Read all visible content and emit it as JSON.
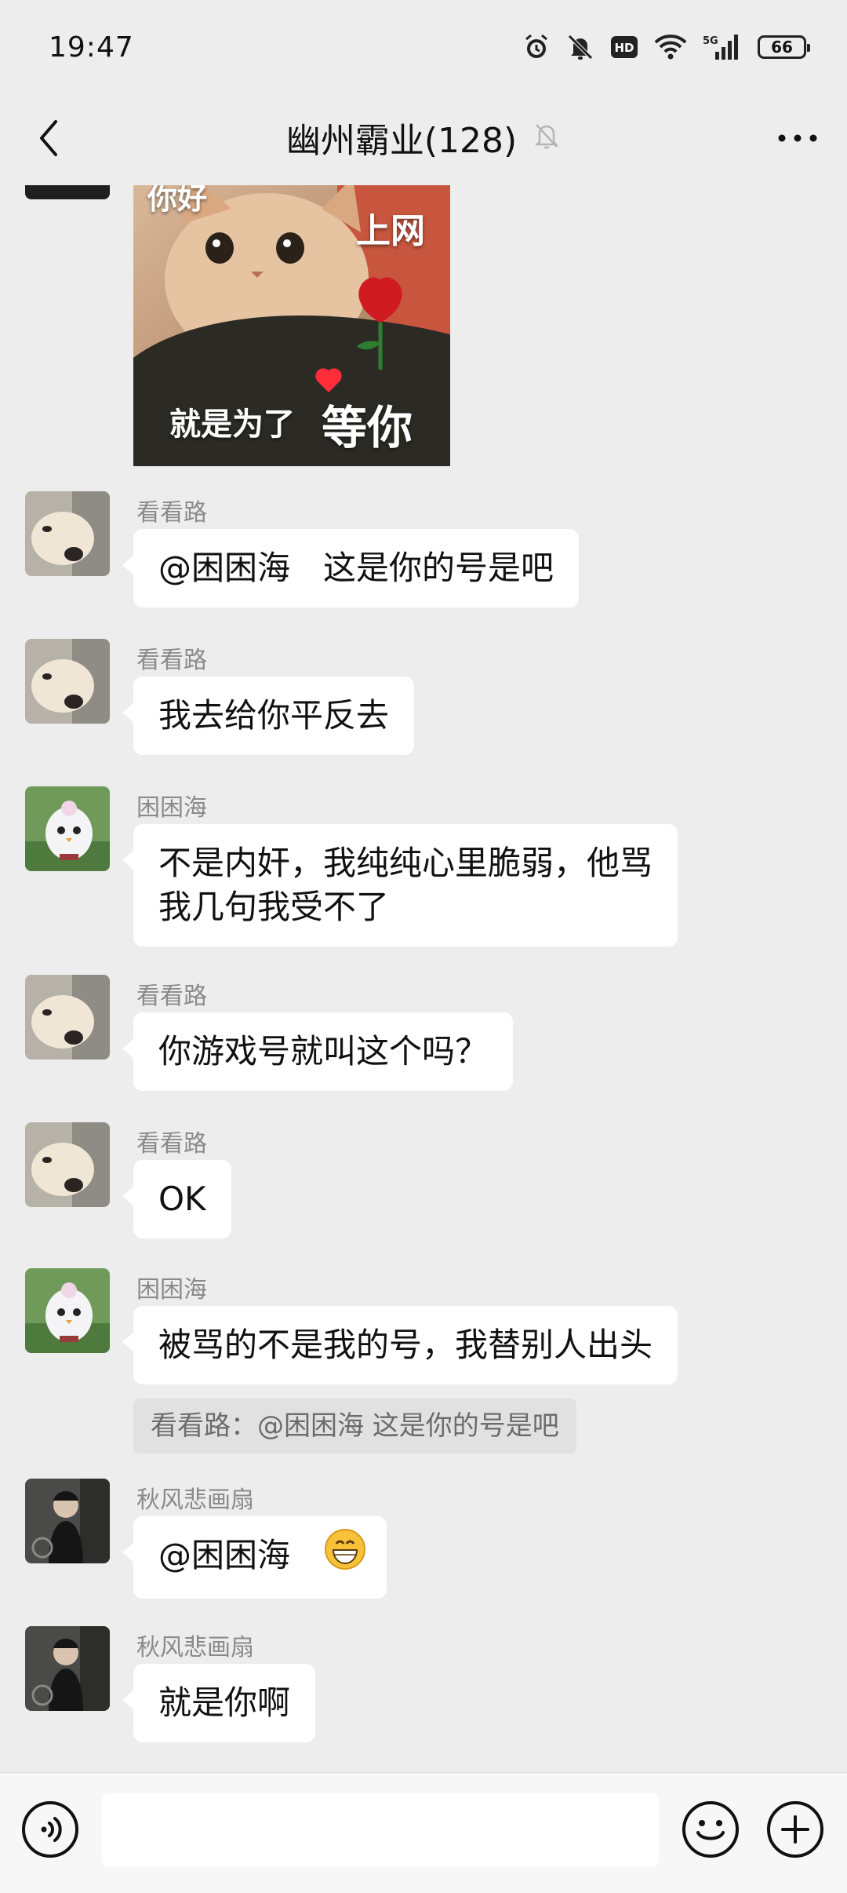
{
  "status_bar": {
    "time": "19:47",
    "battery": "66",
    "network": "5G",
    "hd_badge": "HD",
    "icons": [
      "alarm-icon",
      "mute-icon",
      "hd-icon",
      "wifi-icon",
      "signal-icon",
      "battery-icon"
    ]
  },
  "header": {
    "title": "幽州霸业(128)",
    "back_icon": "chevron-left-icon",
    "muted_icon": "bell-off-icon",
    "more_icon": "more-dots-icon"
  },
  "sticker": {
    "text_top_left": "你好",
    "text_top_right": "上网",
    "text_bottom_small": "就是为了",
    "text_bottom_large": "等你"
  },
  "messages": [
    {
      "sender": "看看路",
      "text": "@困困海　这是你的号是吧"
    },
    {
      "sender": "看看路",
      "text": "我去给你平反去"
    },
    {
      "sender": "困困海",
      "text_line1": "不是内奸，我纯纯心里脆弱，他骂",
      "text_line2": "我几句我受不了"
    },
    {
      "sender": "看看路",
      "text": "你游戏号就叫这个吗？"
    },
    {
      "sender": "看看路",
      "text": "OK"
    },
    {
      "sender": "困困海",
      "text": "被骂的不是我的号，我替别人出头",
      "quote": "看看路：@困困海 这是你的号是吧"
    },
    {
      "sender": "秋风悲画扇",
      "text": "@困困海",
      "emoji": "grinning-emoji"
    },
    {
      "sender": "秋风悲画扇",
      "text": "就是你啊"
    }
  ],
  "input_bar": {
    "placeholder": "",
    "icons": [
      "voice-icon",
      "emoji-icon",
      "plus-icon"
    ]
  },
  "colors": {
    "background": "#ededed",
    "bubble": "#ffffff",
    "quote_bg": "#e1e1e1",
    "sender_gray": "#8a8a8a"
  }
}
